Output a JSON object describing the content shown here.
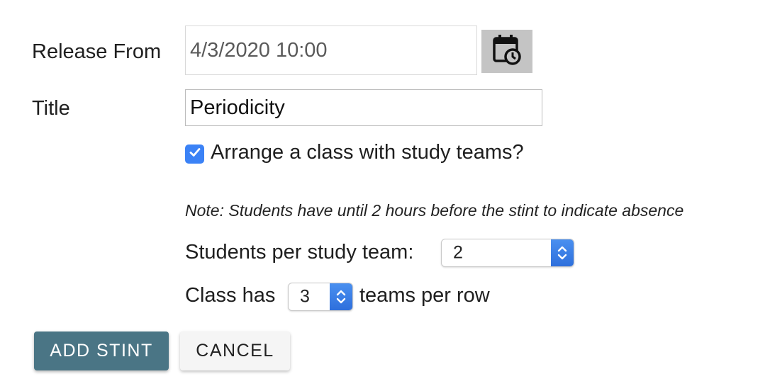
{
  "form": {
    "release_from_label": "Release From",
    "release_from_value": "4/3/2020 10:00",
    "calendar_icon": "calendar-clock-icon",
    "title_label": "Title",
    "title_value": "Periodicity",
    "teams_checkbox_checked": true,
    "teams_checkbox_label": "Arrange a class with study teams?",
    "note": "Note: Students have until 2 hours before the stint to indicate absence",
    "students_per_team_label": "Students per study team:",
    "students_per_team_value": "2",
    "class_has_label": "Class has",
    "teams_per_row_value": "3",
    "teams_per_row_label": "teams per row"
  },
  "actions": {
    "add_label": "ADD STINT",
    "cancel_label": "CANCEL"
  },
  "colors": {
    "primary_button": "#4a7585",
    "checkbox": "#3b82f6",
    "calendar_button_bg": "#c4c4c4"
  }
}
